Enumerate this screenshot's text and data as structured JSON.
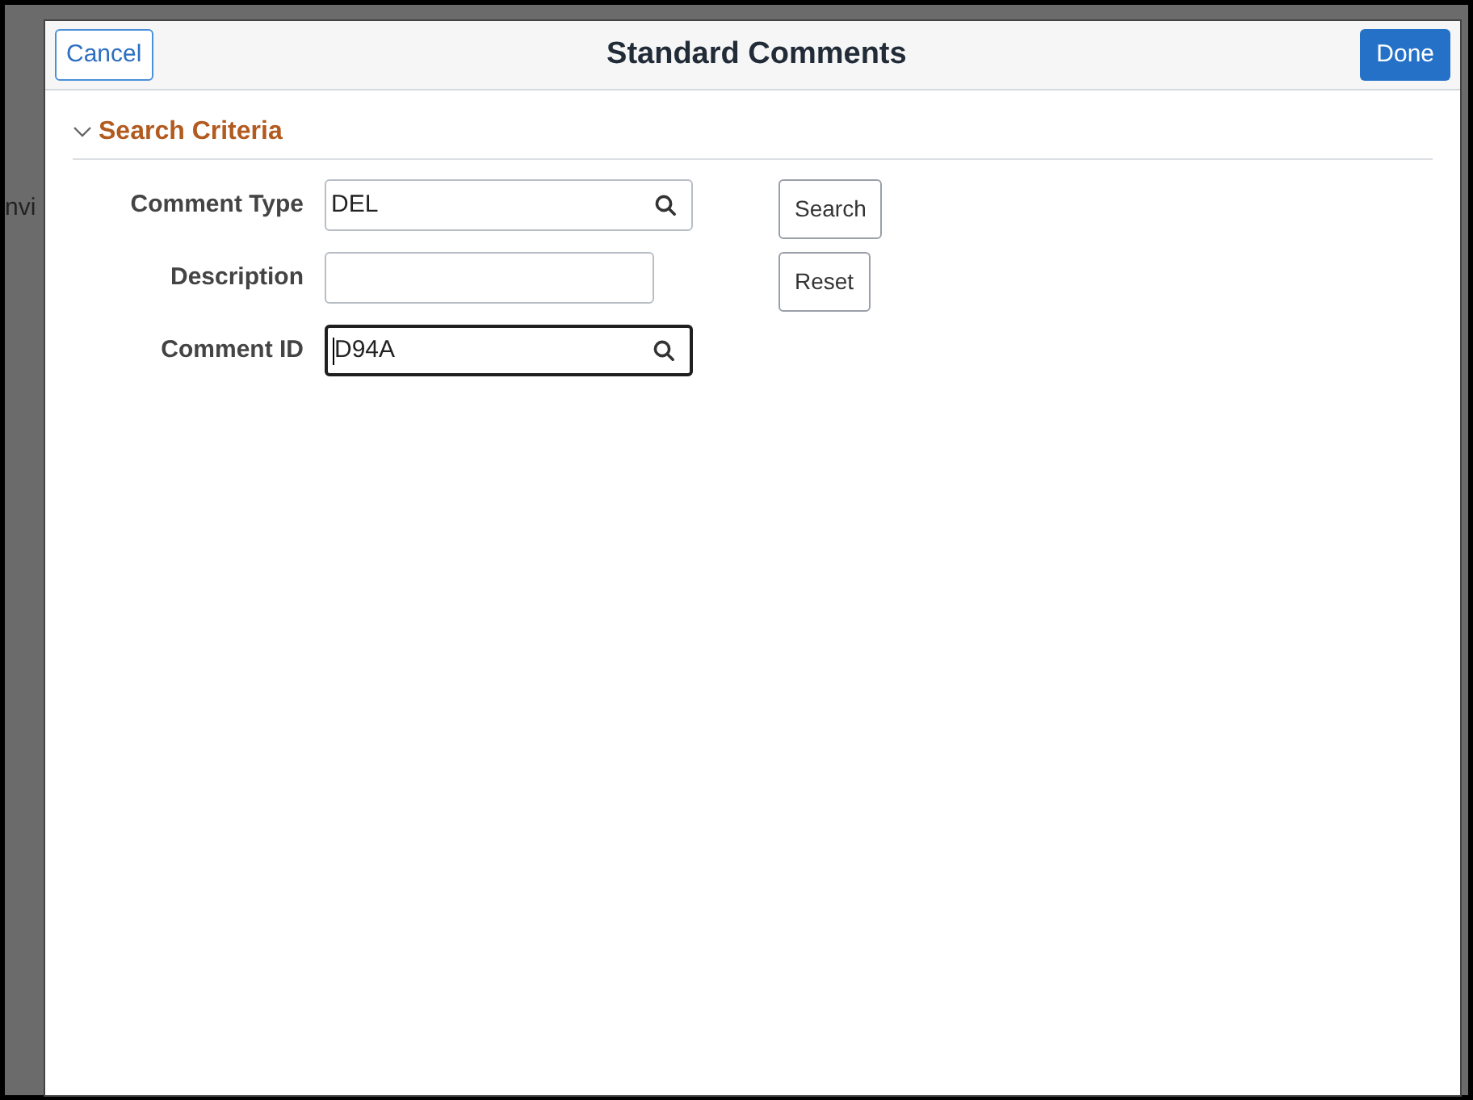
{
  "background": {
    "text_fragment": "nvi"
  },
  "dialog": {
    "title": "Standard Comments",
    "cancel_button": "Cancel",
    "done_button": "Done"
  },
  "section": {
    "title": "Search Criteria",
    "expanded": true
  },
  "fields": [
    {
      "label": "Comment Type",
      "value": "DEL",
      "lookup": true,
      "focused": false
    },
    {
      "label": "Description",
      "lookup": false,
      "focused": false
    },
    {
      "label": "Comment ID",
      "value": "D94A",
      "lookup": true,
      "focused": true
    }
  ],
  "buttons": [
    "Search",
    "Reset"
  ]
}
